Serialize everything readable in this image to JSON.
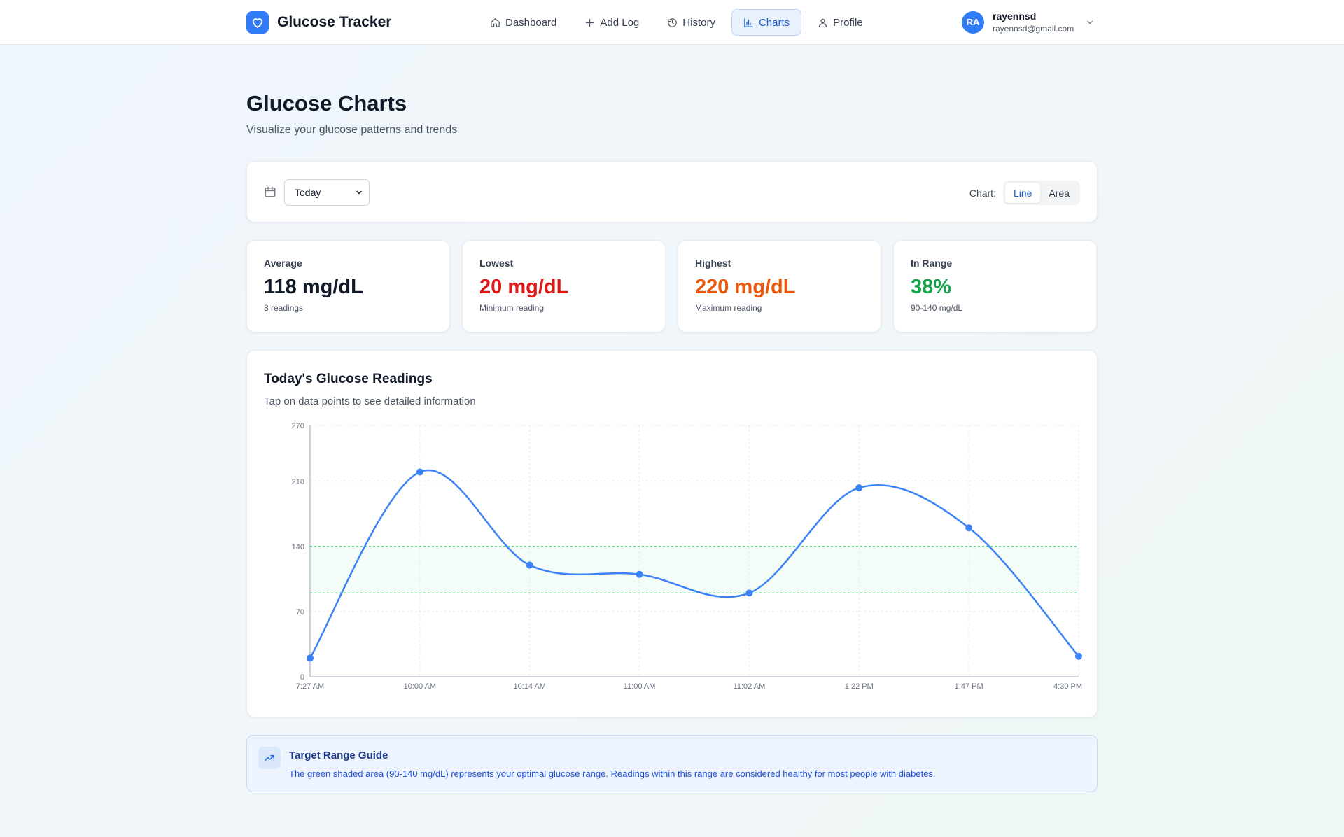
{
  "app": {
    "name": "Glucose Tracker",
    "logo_icon": "heart-icon",
    "brand_color": "#2f7cf6"
  },
  "nav": {
    "items": [
      {
        "label": "Dashboard",
        "icon": "home-icon",
        "active": false
      },
      {
        "label": "Add Log",
        "icon": "plus-icon",
        "active": false
      },
      {
        "label": "History",
        "icon": "history-icon",
        "active": false
      },
      {
        "label": "Charts",
        "icon": "bar-chart-icon",
        "active": true
      },
      {
        "label": "Profile",
        "icon": "user-icon",
        "active": false
      }
    ]
  },
  "user": {
    "initials": "RA",
    "name": "rayennsd",
    "email": "rayennsd@gmail.com"
  },
  "page": {
    "title": "Glucose Charts",
    "subtitle": "Visualize your glucose patterns and trends"
  },
  "filters": {
    "period_selected": "Today",
    "chart_type_label": "Chart:",
    "chart_types": [
      "Line",
      "Area"
    ],
    "chart_type_selected": "Line"
  },
  "stats": [
    {
      "label": "Average",
      "value": "118 mg/dL",
      "sub": "8 readings",
      "color": "#111827"
    },
    {
      "label": "Lowest",
      "value": "20 mg/dL",
      "sub": "Minimum reading",
      "color": "#dc1a1a"
    },
    {
      "label": "Highest",
      "value": "220 mg/dL",
      "sub": "Maximum reading",
      "color": "#ea580c"
    },
    {
      "label": "In Range",
      "value": "38%",
      "sub": "90-140 mg/dL",
      "color": "#16a34a"
    }
  ],
  "chart": {
    "title": "Today's Glucose Readings",
    "subtitle": "Tap on data points to see detailed information"
  },
  "chart_data": {
    "type": "line",
    "title": "Today's Glucose Readings",
    "x": [
      "7:27 AM",
      "10:00 AM",
      "10:14 AM",
      "11:00 AM",
      "11:02 AM",
      "1:22 PM",
      "1:47 PM",
      "4:30 PM"
    ],
    "series": [
      {
        "values": [
          20,
          220,
          120,
          110,
          90,
          203,
          160,
          22
        ]
      }
    ],
    "ylim": [
      0,
      270
    ],
    "yticks": [
      0,
      70,
      140,
      210,
      270
    ],
    "target_range": [
      90,
      140
    ],
    "grid": true,
    "line_color": "#3b82f6",
    "range_color": "#22c55e"
  },
  "guide": {
    "icon": "trending-up-icon",
    "title": "Target Range Guide",
    "text": "The green shaded area (90-140 mg/dL) represents your optimal glucose range. Readings within this range are considered healthy for most people with diabetes."
  }
}
